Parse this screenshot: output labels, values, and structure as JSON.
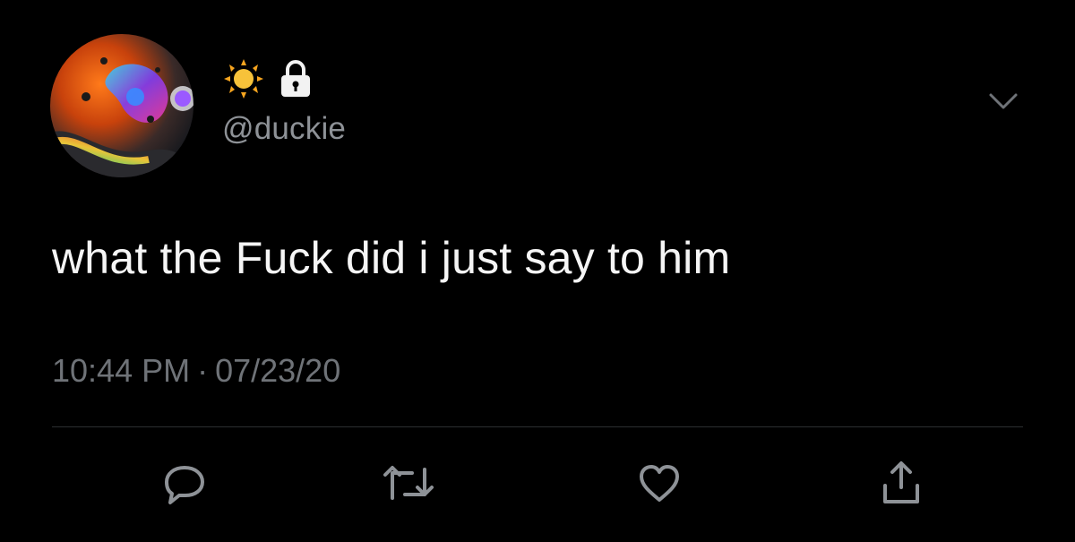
{
  "tweet": {
    "name_icons": [
      "sun-icon",
      "lock-icon"
    ],
    "handle": "@duckie",
    "text": "what the Fuck did i just say to him",
    "time": "10:44 PM",
    "separator": "·",
    "date": "07/23/20"
  },
  "actions": [
    {
      "name": "reply-button",
      "icon": "comment-icon"
    },
    {
      "name": "retweet-button",
      "icon": "retweet-icon"
    },
    {
      "name": "like-button",
      "icon": "heart-icon"
    },
    {
      "name": "share-button",
      "icon": "share-icon"
    }
  ],
  "colors": {
    "background": "#000000",
    "text": "#f5f5f5",
    "secondary": "#8e9297",
    "icon": "#8e9297",
    "sun": "#f7c23a"
  }
}
